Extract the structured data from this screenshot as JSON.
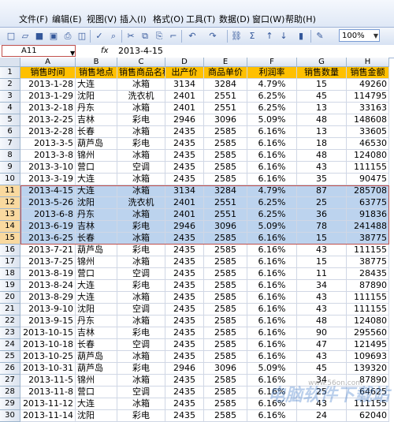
{
  "menu": [
    "文件(F)",
    "编辑(E)",
    "视图(V)",
    "插入(I)",
    "格式(O)",
    "工具(T)",
    "数据(D)",
    "窗口(W)",
    "帮助(H)"
  ],
  "toolbar": {
    "zoom": "100%",
    "icons": [
      "new-icon",
      "open-icon",
      "save-icon",
      "permission-icon",
      "print-icon",
      "print-preview-icon",
      "spellcheck-icon",
      "research-icon",
      "cut-icon",
      "copy-icon",
      "paste-icon",
      "format-painter-icon",
      "undo-icon",
      "redo-icon",
      "hyperlink-icon",
      "autosum-icon",
      "sort-ascending-icon",
      "sort-descending-icon",
      "chart-icon",
      "drawing-icon"
    ]
  },
  "formula_bar": {
    "name_box": "A11",
    "fx": "fx",
    "value": "2013-4-15"
  },
  "columns": [
    "A",
    "B",
    "C",
    "D",
    "E",
    "F",
    "G",
    "H"
  ],
  "header_row": [
    "销售时间",
    "销售地点",
    "销售商品名称",
    "出产价",
    "商品单价",
    "利润率",
    "销售数量",
    "销售金额"
  ],
  "rows": [
    [
      "2013-1-28",
      "大连",
      "冰箱",
      "3134",
      "3284",
      "4.79%",
      "15",
      "49260"
    ],
    [
      "2013-1-29",
      "沈阳",
      "洗衣机",
      "2401",
      "2551",
      "6.25%",
      "45",
      "114795"
    ],
    [
      "2013-2-18",
      "丹东",
      "冰箱",
      "2401",
      "2551",
      "6.25%",
      "13",
      "33163"
    ],
    [
      "2013-2-25",
      "吉林",
      "彩电",
      "2946",
      "3096",
      "5.09%",
      "48",
      "148608"
    ],
    [
      "2013-2-28",
      "长春",
      "冰箱",
      "2435",
      "2585",
      "6.16%",
      "13",
      "33605"
    ],
    [
      "2013-3-5",
      "葫芦岛",
      "彩电",
      "2435",
      "2585",
      "6.16%",
      "18",
      "46530"
    ],
    [
      "2013-3-8",
      "锦州",
      "冰箱",
      "2435",
      "2585",
      "6.16%",
      "48",
      "124080"
    ],
    [
      "2013-3-10",
      "营口",
      "空调",
      "2435",
      "2585",
      "6.16%",
      "43",
      "111155"
    ],
    [
      "2013-3-19",
      "大连",
      "冰箱",
      "2435",
      "2585",
      "6.16%",
      "35",
      "90475"
    ],
    [
      "2013-4-15",
      "大连",
      "冰箱",
      "3134",
      "3284",
      "4.79%",
      "87",
      "285708"
    ],
    [
      "2013-5-26",
      "沈阳",
      "洗衣机",
      "2401",
      "2551",
      "6.25%",
      "25",
      "63775"
    ],
    [
      "2013-6-8",
      "丹东",
      "冰箱",
      "2401",
      "2551",
      "6.25%",
      "36",
      "91836"
    ],
    [
      "2013-6-19",
      "吉林",
      "彩电",
      "2946",
      "3096",
      "5.09%",
      "78",
      "241488"
    ],
    [
      "2013-6-25",
      "长春",
      "冰箱",
      "2435",
      "2585",
      "6.16%",
      "15",
      "38775"
    ],
    [
      "2013-7-21",
      "葫芦岛",
      "彩电",
      "2435",
      "2585",
      "6.16%",
      "43",
      "111155"
    ],
    [
      "2013-7-25",
      "锦州",
      "冰箱",
      "2435",
      "2585",
      "6.16%",
      "15",
      "38775"
    ],
    [
      "2013-8-19",
      "营口",
      "空调",
      "2435",
      "2585",
      "6.16%",
      "11",
      "28435"
    ],
    [
      "2013-8-24",
      "大连",
      "彩电",
      "2435",
      "2585",
      "6.16%",
      "34",
      "87890"
    ],
    [
      "2013-8-29",
      "大连",
      "冰箱",
      "2435",
      "2585",
      "6.16%",
      "43",
      "111155"
    ],
    [
      "2013-9-10",
      "沈阳",
      "空调",
      "2435",
      "2585",
      "6.16%",
      "43",
      "111155"
    ],
    [
      "2013-9-15",
      "丹东",
      "冰箱",
      "2435",
      "2585",
      "6.16%",
      "48",
      "124080"
    ],
    [
      "2013-10-15",
      "吉林",
      "彩电",
      "2435",
      "2585",
      "6.16%",
      "90",
      "295560"
    ],
    [
      "2013-10-18",
      "长春",
      "空调",
      "2435",
      "2585",
      "6.16%",
      "47",
      "121495"
    ],
    [
      "2013-10-25",
      "葫芦岛",
      "冰箱",
      "2435",
      "2585",
      "6.16%",
      "43",
      "109693"
    ],
    [
      "2013-10-31",
      "葫芦岛",
      "彩电",
      "2946",
      "3096",
      "5.09%",
      "45",
      "139320"
    ],
    [
      "2013-11-5",
      "锦州",
      "冰箱",
      "2435",
      "2585",
      "6.16%",
      "34",
      "87890"
    ],
    [
      "2013-11-8",
      "营口",
      "空调",
      "2435",
      "2585",
      "6.16%",
      "25",
      "64625"
    ],
    [
      "2013-11-12",
      "大连",
      "冰箱",
      "2435",
      "2585",
      "6.16%",
      "43",
      "111155"
    ],
    [
      "2013-11-14",
      "沈阳",
      "彩电",
      "2435",
      "2585",
      "6.16%",
      "24",
      "62040"
    ]
  ],
  "row_numbers": [
    "1",
    "2",
    "3",
    "4",
    "5",
    "6",
    "7",
    "8",
    "9",
    "10",
    "11",
    "12",
    "13",
    "14",
    "15",
    "16",
    "17",
    "18",
    "19",
    "20",
    "21",
    "22",
    "23",
    "24",
    "25",
    "26",
    "27",
    "28",
    "29",
    "30"
  ],
  "selected_rows": [
    11,
    12,
    13,
    14,
    15
  ],
  "watermark": "电脑软件下载站",
  "watermark_url": "www.56on.com",
  "colors": {
    "header_fill": "#ffc000",
    "selection_fill": "#bcd3ee",
    "selection_border": "#c0504d"
  }
}
